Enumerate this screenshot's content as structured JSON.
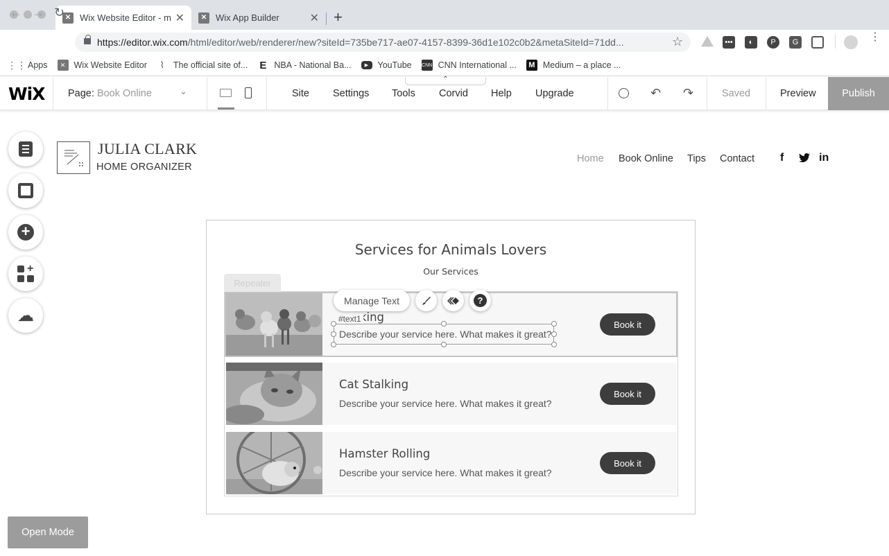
{
  "browser": {
    "tabs": [
      {
        "title": "Wix Website Editor - m",
        "active": true
      },
      {
        "title": "Wix App Builder",
        "active": false
      }
    ],
    "url_host": "https://editor.wix.com",
    "url_path": "/html/editor/web/renderer/new?siteId=735be717-ae07-4157-8399-36d1e102c0b2&metaSiteId=71dd...",
    "bookmarks": [
      {
        "label": "Apps",
        "icon": "apps-grid-icon"
      },
      {
        "label": "Wix Website Editor",
        "icon": "wix-icon"
      },
      {
        "label": "The official site of...",
        "icon": "nfl-icon"
      },
      {
        "label": "NBA - National Ba...",
        "icon": "nba-icon"
      },
      {
        "label": "YouTube",
        "icon": "youtube-icon"
      },
      {
        "label": "CNN International ...",
        "icon": "cnn-icon"
      },
      {
        "label": "Medium – a place ...",
        "icon": "medium-icon"
      }
    ],
    "bookmark_icon_text": {
      "cnn": "CNN",
      "medium": "M",
      "nfl": "⌇",
      "nba": "E"
    }
  },
  "wix": {
    "logo": "WiX",
    "page_label": "Page:",
    "page_value": "Book Online",
    "menu": [
      "Site",
      "Settings",
      "Tools",
      "Corvid",
      "Help",
      "Upgrade"
    ],
    "saved": "Saved",
    "preview": "Preview",
    "publish": "Publish",
    "open_mode": "Open Mode"
  },
  "site": {
    "name": "JULIA CLARK",
    "subtitle": "HOME ORGANIZER",
    "nav": [
      "Home",
      "Book Online",
      "Tips",
      "Contact"
    ],
    "social": [
      "f",
      "t",
      "in"
    ]
  },
  "services": {
    "title": "Services for Animals Lovers",
    "subtitle": "Our Services",
    "repeater_tag": "Repeater",
    "manage_text": "Manage Text",
    "text_id": "#text1",
    "items": [
      {
        "name": "Walking",
        "desc": "Describe your service here. What makes it great?",
        "button": "Book it"
      },
      {
        "name": "Cat Stalking",
        "desc": "Describe your service here. What makes it great?",
        "button": "Book it"
      },
      {
        "name": "Hamster Rolling",
        "desc": "Describe your service here. What makes it great?",
        "button": "Book it"
      }
    ]
  },
  "colors": {
    "publish_bg": "#9c9c9c",
    "book_button_bg": "#3d3d3d",
    "nav_active": "#999999"
  }
}
